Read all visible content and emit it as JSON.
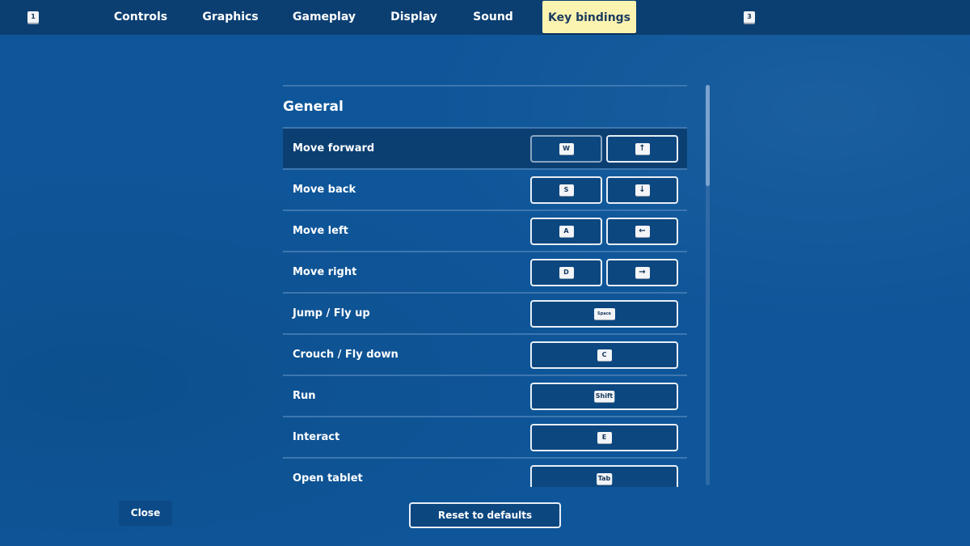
{
  "topbar": {
    "left_hint": "1",
    "right_hint": "3",
    "tabs": [
      {
        "label": "Controls"
      },
      {
        "label": "Graphics"
      },
      {
        "label": "Gameplay"
      },
      {
        "label": "Display"
      },
      {
        "label": "Sound"
      },
      {
        "label": "Key bindings",
        "active": true
      }
    ]
  },
  "section": {
    "title": "General",
    "rows": [
      {
        "label": "Move forward",
        "primary": "W",
        "secondary": "↑",
        "selected": true
      },
      {
        "label": "Move back",
        "primary": "S",
        "secondary": "↓"
      },
      {
        "label": "Move left",
        "primary": "A",
        "secondary": "←"
      },
      {
        "label": "Move right",
        "primary": "D",
        "secondary": "→"
      },
      {
        "label": "Jump / Fly up",
        "primary": "Space"
      },
      {
        "label": "Crouch / Fly down",
        "primary": "C"
      },
      {
        "label": "Run",
        "primary": "Shift"
      },
      {
        "label": "Interact",
        "primary": "E"
      },
      {
        "label": "Open tablet",
        "primary": "Tab"
      }
    ]
  },
  "buttons": {
    "close": "Close",
    "reset": "Reset to defaults"
  },
  "colors": {
    "background": "#0e5699",
    "topbar": "#0b3f72",
    "active_tab": "#fbf3b0"
  }
}
